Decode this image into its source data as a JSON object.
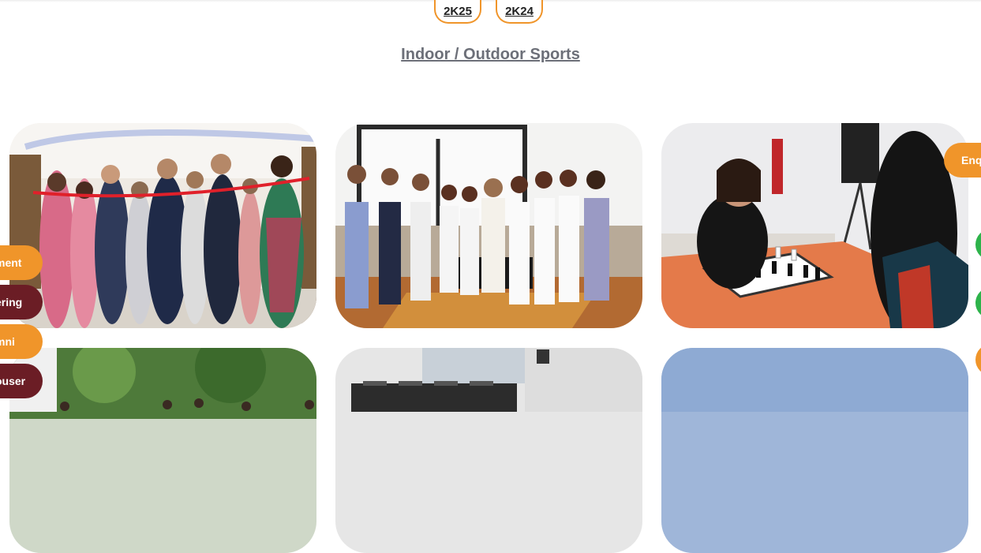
{
  "years": [
    "2K25",
    "2K24"
  ],
  "section_title": "Indoor / Outdoor Sports",
  "side_tabs": [
    {
      "label": "ment",
      "color": "#f0952a"
    },
    {
      "label": "ering",
      "color": "#6b1d25"
    },
    {
      "label": "mni",
      "color": "#f0952a"
    },
    {
      "label": "ouser",
      "color": "#6b1d25"
    }
  ],
  "enquire": {
    "label": "Enq"
  },
  "colors": {
    "accent": "#f0952a",
    "maroon": "#6b1d25",
    "green": "#2db34a",
    "link": "#6c6f78"
  },
  "gallery": [
    {
      "name": "ribbon-cutting-photo"
    },
    {
      "name": "group-photo-lounge"
    },
    {
      "name": "chess-game-photo"
    },
    {
      "name": "outdoor-crowd-photo"
    },
    {
      "name": "gym-interior-photo"
    },
    {
      "name": "sky-field-photo"
    }
  ]
}
